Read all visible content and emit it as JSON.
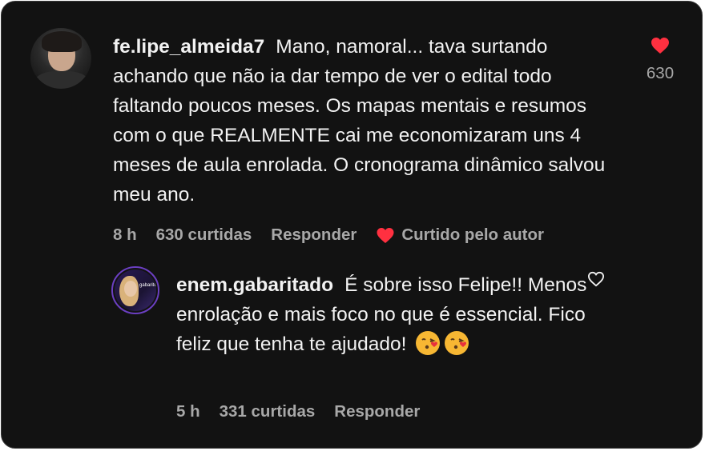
{
  "colors": {
    "background": "#121212",
    "text": "#f2f2f2",
    "muted": "#a8a8a8",
    "heart": "#ff3040",
    "ring": "#6b3fc2"
  },
  "comment": {
    "username": "fe.lipe_almeida7",
    "text": "Mano, namoral... tava surtando achando que não ia dar tempo de ver o edital todo faltando poucos meses. Os mapas mentais e resumos com o que REALMENTE cai me economizaram uns 4 meses de aula enrolada. O cronograma dinâmico salvou meu ano.",
    "time": "8 h",
    "likes_label": "630 curtidas",
    "reply_label": "Responder",
    "liked_by_author": "Curtido pelo autor",
    "like_count": "630",
    "like_icon": "heart-filled-icon"
  },
  "reply": {
    "username": "enem.gabaritado",
    "text": "É sobre isso Felipe!! Menos enrolação e mais foco no que é essencial. Fico feliz que tenha te ajudado!",
    "emojis": [
      "face-blowing-kiss-icon",
      "face-blowing-kiss-icon"
    ],
    "avatar_logo": "gabarito",
    "time": "5 h",
    "likes_label": "331 curtidas",
    "reply_label": "Responder",
    "like_icon": "heart-outline-icon"
  }
}
